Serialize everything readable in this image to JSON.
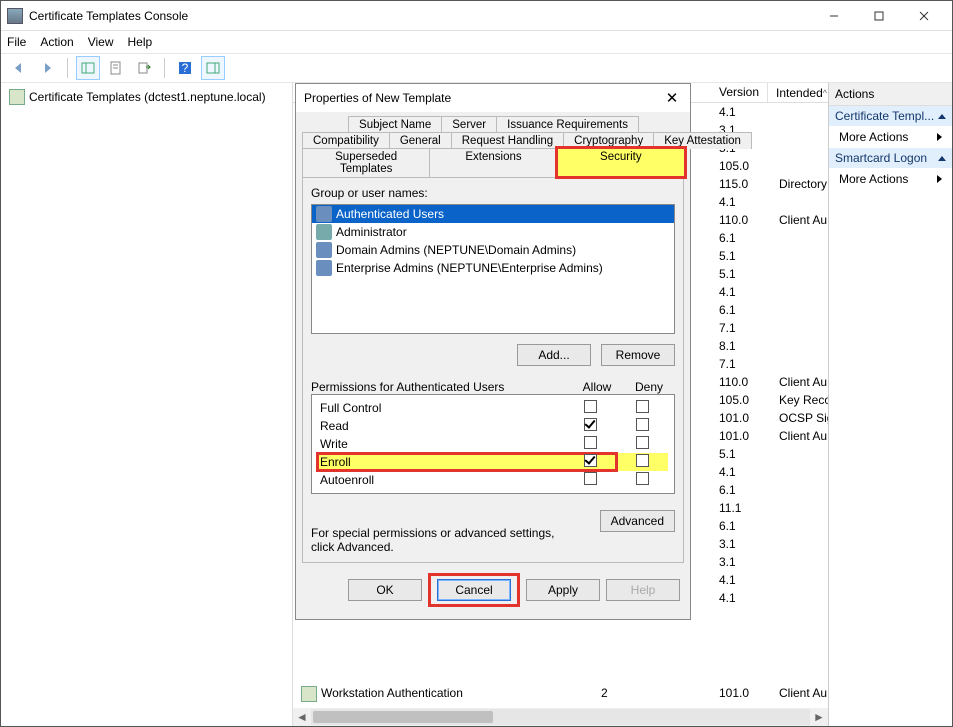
{
  "window": {
    "title": "Certificate Templates Console",
    "menu": [
      "File",
      "Action",
      "View",
      "Help"
    ]
  },
  "left_panel": {
    "node": "Certificate Templates (dctest1.neptune.local)"
  },
  "template_columns": {
    "c1": "Version",
    "c2": "Intended"
  },
  "template_rows": [
    {
      "version": "4.1",
      "intended": ""
    },
    {
      "version": "3.1",
      "intended": ""
    },
    {
      "version": "5.1",
      "intended": ""
    },
    {
      "version": "105.0",
      "intended": ""
    },
    {
      "version": "115.0",
      "intended": "Directory"
    },
    {
      "version": "4.1",
      "intended": ""
    },
    {
      "version": "110.0",
      "intended": "Client Au"
    },
    {
      "version": "6.1",
      "intended": ""
    },
    {
      "version": "5.1",
      "intended": ""
    },
    {
      "version": "5.1",
      "intended": ""
    },
    {
      "version": "4.1",
      "intended": ""
    },
    {
      "version": "6.1",
      "intended": ""
    },
    {
      "version": "7.1",
      "intended": ""
    },
    {
      "version": "8.1",
      "intended": ""
    },
    {
      "version": "7.1",
      "intended": ""
    },
    {
      "version": "110.0",
      "intended": "Client Au"
    },
    {
      "version": "105.0",
      "intended": "Key Reco"
    },
    {
      "version": "101.0",
      "intended": "OCSP Sig"
    },
    {
      "version": "101.0",
      "intended": "Client Au"
    },
    {
      "version": "5.1",
      "intended": ""
    },
    {
      "version": "4.1",
      "intended": ""
    },
    {
      "version": "6.1",
      "intended": ""
    },
    {
      "version": "11.1",
      "intended": ""
    },
    {
      "version": "6.1",
      "intended": ""
    },
    {
      "version": "3.1",
      "intended": ""
    },
    {
      "version": "3.1",
      "intended": ""
    },
    {
      "version": "4.1",
      "intended": ""
    },
    {
      "version": "4.1",
      "intended": ""
    }
  ],
  "extra_template": {
    "name": "Workstation Authentication",
    "col2": "2",
    "version": "101.0",
    "intended": "Client Au"
  },
  "dialog": {
    "title": "Properties of New Template",
    "tabs_row1": [
      "Subject Name",
      "Server",
      "Issuance Requirements"
    ],
    "tabs_row2": [
      "Compatibility",
      "General",
      "Request Handling",
      "Cryptography",
      "Key Attestation"
    ],
    "tabs_row3": [
      "Superseded Templates",
      "Extensions",
      "Security"
    ],
    "group_label": "Group or user names:",
    "groups": [
      {
        "name": "Authenticated Users",
        "selected": true,
        "multi": true
      },
      {
        "name": "Administrator",
        "selected": false,
        "multi": false
      },
      {
        "name": "Domain Admins (NEPTUNE\\Domain Admins)",
        "selected": false,
        "multi": true
      },
      {
        "name": "Enterprise Admins (NEPTUNE\\Enterprise Admins)",
        "selected": false,
        "multi": true
      }
    ],
    "add_label": "Add...",
    "remove_label": "Remove",
    "perm_label": "Permissions for Authenticated Users",
    "allow_label": "Allow",
    "deny_label": "Deny",
    "permissions": [
      {
        "name": "Full Control",
        "allow": false,
        "deny": false,
        "hl": false
      },
      {
        "name": "Read",
        "allow": true,
        "deny": false,
        "hl": false
      },
      {
        "name": "Write",
        "allow": false,
        "deny": false,
        "hl": false
      },
      {
        "name": "Enroll",
        "allow": true,
        "deny": false,
        "hl": true
      },
      {
        "name": "Autoenroll",
        "allow": false,
        "deny": false,
        "hl": false
      }
    ],
    "special_text": "For special permissions or advanced settings, click Advanced.",
    "advanced_label": "Advanced",
    "ok_label": "OK",
    "cancel_label": "Cancel",
    "apply_label": "Apply",
    "help_label": "Help"
  },
  "actions_panel": {
    "title": "Actions",
    "sec1": "Certificate Templ...",
    "sec2": "Smartcard Logon",
    "more": "More Actions"
  }
}
